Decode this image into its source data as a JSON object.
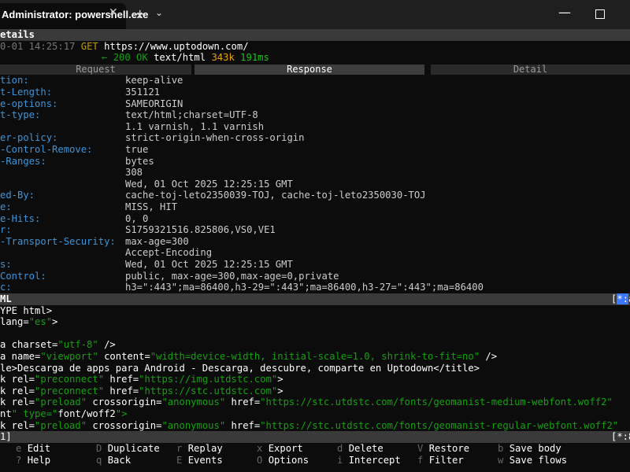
{
  "window": {
    "tab_title": "Administrator: powershell.exe",
    "close_glyph": "✕",
    "new_tab_glyph": "+",
    "dropdown_glyph": "⌄",
    "minimize_glyph": "—"
  },
  "flow": {
    "section_title": "etails",
    "timestamp": "0-01 14:25:17",
    "method": "GET",
    "url": "https://www.uptodown.com/",
    "arrow": "←",
    "status": "200 OK",
    "content_type": "text/html",
    "size": "343k",
    "duration": "191ms"
  },
  "subtabs": [
    "Request",
    "Response",
    "Detail"
  ],
  "headers": [
    {
      "key": "tion:",
      "value": "keep-alive"
    },
    {
      "key": "t-Length:",
      "value": "351121"
    },
    {
      "key": "e-options:",
      "value": "SAMEORIGIN"
    },
    {
      "key": "t-type:",
      "value": "text/html;charset=UTF-8"
    },
    {
      "key": "",
      "value": "1.1 varnish, 1.1 varnish"
    },
    {
      "key": "er-policy:",
      "value": "strict-origin-when-cross-origin"
    },
    {
      "key": "-Control-Remove:",
      "value": "true"
    },
    {
      "key": "-Ranges:",
      "value": "bytes"
    },
    {
      "key": "",
      "value": "308"
    },
    {
      "key": "",
      "value": "Wed, 01 Oct 2025 12:25:15 GMT"
    },
    {
      "key": "ed-By:",
      "value": "cache-toj-leto2350039-TOJ, cache-toj-leto2350030-TOJ"
    },
    {
      "key": "e:",
      "value": "MISS, HIT"
    },
    {
      "key": "e-Hits:",
      "value": "0, 0"
    },
    {
      "key": "r:",
      "value": "S1759321516.825806,VS0,VE1"
    },
    {
      "key": "-Transport-Security:",
      "value": "max-age=300"
    },
    {
      "key": "",
      "value": "Accept-Encoding"
    },
    {
      "key": "s:",
      "value": "Wed, 01 Oct 2025 12:25:15 GMT"
    },
    {
      "key": "Control:",
      "value": "public, max-age=300,max-age=0,private"
    },
    {
      "key": "c:",
      "value": "h3=\":443\";ma=86400,h3-29=\":443\";ma=86400,h3-27=\":443\";ma=86400"
    }
  ],
  "body_bar": {
    "title": "ML",
    "right_open": "[",
    "right_highlight": "*:",
    "right_rest": "a"
  },
  "body_lines": [
    "YPE html>",
    "lang=\"es\">",
    "",
    "a charset=\"utf-8\" />",
    "a name=\"viewport\" content=\"width=device-width, initial-scale=1.0, shrink-to-fit=no\" />",
    "le>Descarga de apps para Android - Descarga, descubre, comparte en Uptodown</title>",
    "k rel=\"preconnect\" href=\"https://img.utdstc.com\">",
    "k rel=\"preconnect\" href=\"https://stc.utdstc.com\">",
    "k rel=\"preload\" crossorigin=\"anonymous\" href=\"https://stc.utdstc.com/fonts/geomanist-medium-webfont.woff2\"",
    "nt\" type=\"font/woff2\">",
    "k rel=\"preload\" crossorigin=\"anonymous\" href=\"https://stc.utdstc.com/fonts/geomanist-regular-webfont.woff2\""
  ],
  "status_bar": {
    "left": "1]",
    "right": "[*:8"
  },
  "keybindings": [
    [
      {
        "key": "e",
        "label": "Edit"
      },
      {
        "key": "D",
        "label": "Duplicate"
      },
      {
        "key": "r",
        "label": "Replay"
      },
      {
        "key": "x",
        "label": "Export"
      },
      {
        "key": "d",
        "label": "Delete"
      },
      {
        "key": "V",
        "label": "Restore"
      },
      {
        "key": "b",
        "label": "Save body"
      }
    ],
    [
      {
        "key": "?",
        "label": "Help"
      },
      {
        "key": "q",
        "label": "Back"
      },
      {
        "key": "E",
        "label": "Events"
      },
      {
        "key": "O",
        "label": "Options"
      },
      {
        "key": "i",
        "label": "Intercept"
      },
      {
        "key": "f",
        "label": "Filter"
      },
      {
        "key": "w",
        "label": "Save flows"
      }
    ]
  ],
  "colors": {
    "header_key": "#3a96dd",
    "status_ok": "#13a10e",
    "size": "#e5a50a",
    "duration": "#16c60c",
    "bar_bg": "#3a3a3a",
    "highlight": "#3b78ff"
  }
}
